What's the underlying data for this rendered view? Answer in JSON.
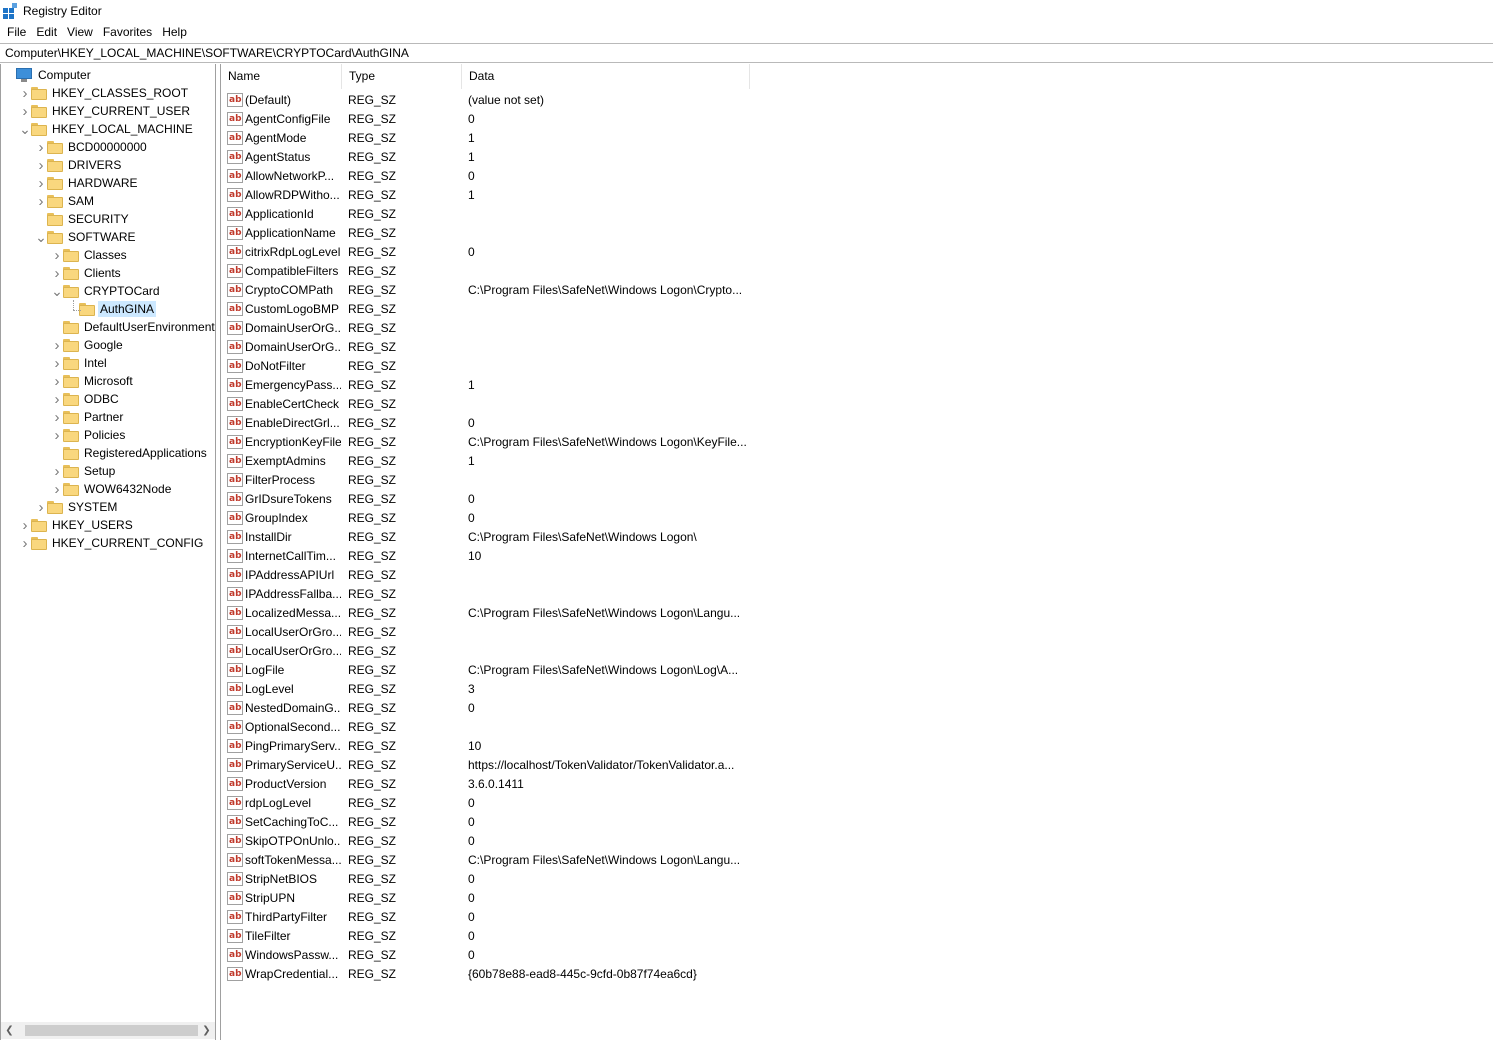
{
  "window": {
    "title": "Registry Editor"
  },
  "menu": [
    "File",
    "Edit",
    "View",
    "Favorites",
    "Help"
  ],
  "address": "Computer\\HKEY_LOCAL_MACHINE\\SOFTWARE\\CRYPTOCard\\AuthGINA",
  "tree": [
    {
      "label": "Computer",
      "depth": 0,
      "icon": "computer",
      "expander": "down"
    },
    {
      "label": "HKEY_CLASSES_ROOT",
      "depth": 1,
      "icon": "folder",
      "expander": "right"
    },
    {
      "label": "HKEY_CURRENT_USER",
      "depth": 1,
      "icon": "folder",
      "expander": "right"
    },
    {
      "label": "HKEY_LOCAL_MACHINE",
      "depth": 1,
      "icon": "folder",
      "expander": "down"
    },
    {
      "label": "BCD00000000",
      "depth": 2,
      "icon": "folder",
      "expander": "right"
    },
    {
      "label": "DRIVERS",
      "depth": 2,
      "icon": "folder",
      "expander": "right"
    },
    {
      "label": "HARDWARE",
      "depth": 2,
      "icon": "folder",
      "expander": "right"
    },
    {
      "label": "SAM",
      "depth": 2,
      "icon": "folder",
      "expander": "right"
    },
    {
      "label": "SECURITY",
      "depth": 2,
      "icon": "folder",
      "expander": "none"
    },
    {
      "label": "SOFTWARE",
      "depth": 2,
      "icon": "folder",
      "expander": "down"
    },
    {
      "label": "Classes",
      "depth": 3,
      "icon": "folder",
      "expander": "right"
    },
    {
      "label": "Clients",
      "depth": 3,
      "icon": "folder",
      "expander": "right"
    },
    {
      "label": "CRYPTOCard",
      "depth": 3,
      "icon": "folder",
      "expander": "down"
    },
    {
      "label": "AuthGINA",
      "depth": 4,
      "icon": "folder",
      "expander": "none",
      "selected": true
    },
    {
      "label": "DefaultUserEnvironment",
      "depth": 3,
      "icon": "folder",
      "expander": "none"
    },
    {
      "label": "Google",
      "depth": 3,
      "icon": "folder",
      "expander": "right"
    },
    {
      "label": "Intel",
      "depth": 3,
      "icon": "folder",
      "expander": "right"
    },
    {
      "label": "Microsoft",
      "depth": 3,
      "icon": "folder",
      "expander": "right"
    },
    {
      "label": "ODBC",
      "depth": 3,
      "icon": "folder",
      "expander": "right"
    },
    {
      "label": "Partner",
      "depth": 3,
      "icon": "folder",
      "expander": "right"
    },
    {
      "label": "Policies",
      "depth": 3,
      "icon": "folder",
      "expander": "right"
    },
    {
      "label": "RegisteredApplications",
      "depth": 3,
      "icon": "folder",
      "expander": "none"
    },
    {
      "label": "Setup",
      "depth": 3,
      "icon": "folder",
      "expander": "right"
    },
    {
      "label": "WOW6432Node",
      "depth": 3,
      "icon": "folder",
      "expander": "right"
    },
    {
      "label": "SYSTEM",
      "depth": 2,
      "icon": "folder",
      "expander": "right"
    },
    {
      "label": "HKEY_USERS",
      "depth": 1,
      "icon": "folder",
      "expander": "right"
    },
    {
      "label": "HKEY_CURRENT_CONFIG",
      "depth": 1,
      "icon": "folder",
      "expander": "right"
    }
  ],
  "columns": [
    "Name",
    "Type",
    "Data"
  ],
  "values": [
    {
      "name": "(Default)",
      "type": "REG_SZ",
      "data": "(value not set)"
    },
    {
      "name": "AgentConfigFile",
      "type": "REG_SZ",
      "data": "0"
    },
    {
      "name": "AgentMode",
      "type": "REG_SZ",
      "data": "1"
    },
    {
      "name": "AgentStatus",
      "type": "REG_SZ",
      "data": "1"
    },
    {
      "name": "AllowNetworkP...",
      "type": "REG_SZ",
      "data": "0"
    },
    {
      "name": "AllowRDPWitho...",
      "type": "REG_SZ",
      "data": "1"
    },
    {
      "name": "ApplicationId",
      "type": "REG_SZ",
      "data": ""
    },
    {
      "name": "ApplicationName",
      "type": "REG_SZ",
      "data": ""
    },
    {
      "name": "citrixRdpLogLevel",
      "type": "REG_SZ",
      "data": "0"
    },
    {
      "name": "CompatibleFilters",
      "type": "REG_SZ",
      "data": ""
    },
    {
      "name": "CryptoCOMPath",
      "type": "REG_SZ",
      "data": "C:\\Program Files\\SafeNet\\Windows Logon\\Crypto..."
    },
    {
      "name": "CustomLogoBMP",
      "type": "REG_SZ",
      "data": ""
    },
    {
      "name": "DomainUserOrG...",
      "type": "REG_SZ",
      "data": ""
    },
    {
      "name": "DomainUserOrG...",
      "type": "REG_SZ",
      "data": ""
    },
    {
      "name": "DoNotFilter",
      "type": "REG_SZ",
      "data": ""
    },
    {
      "name": "EmergencyPass...",
      "type": "REG_SZ",
      "data": "1"
    },
    {
      "name": "EnableCertCheck",
      "type": "REG_SZ",
      "data": ""
    },
    {
      "name": "EnableDirectGrl...",
      "type": "REG_SZ",
      "data": "0"
    },
    {
      "name": "EncryptionKeyFile",
      "type": "REG_SZ",
      "data": "C:\\Program Files\\SafeNet\\Windows Logon\\KeyFile..."
    },
    {
      "name": "ExemptAdmins",
      "type": "REG_SZ",
      "data": "1"
    },
    {
      "name": "FilterProcess",
      "type": "REG_SZ",
      "data": ""
    },
    {
      "name": "GrIDsureTokens",
      "type": "REG_SZ",
      "data": "0"
    },
    {
      "name": "GroupIndex",
      "type": "REG_SZ",
      "data": "0"
    },
    {
      "name": "InstallDir",
      "type": "REG_SZ",
      "data": "C:\\Program Files\\SafeNet\\Windows Logon\\"
    },
    {
      "name": "InternetCallTim...",
      "type": "REG_SZ",
      "data": "10"
    },
    {
      "name": "IPAddressAPIUrl",
      "type": "REG_SZ",
      "data": ""
    },
    {
      "name": "IPAddressFallba...",
      "type": "REG_SZ",
      "data": ""
    },
    {
      "name": "LocalizedMessa...",
      "type": "REG_SZ",
      "data": "C:\\Program Files\\SafeNet\\Windows Logon\\Langu..."
    },
    {
      "name": "LocalUserOrGro...",
      "type": "REG_SZ",
      "data": ""
    },
    {
      "name": "LocalUserOrGro...",
      "type": "REG_SZ",
      "data": ""
    },
    {
      "name": "LogFile",
      "type": "REG_SZ",
      "data": "C:\\Program Files\\SafeNet\\Windows Logon\\Log\\A..."
    },
    {
      "name": "LogLevel",
      "type": "REG_SZ",
      "data": "3"
    },
    {
      "name": "NestedDomainG...",
      "type": "REG_SZ",
      "data": "0"
    },
    {
      "name": "OptionalSecond...",
      "type": "REG_SZ",
      "data": ""
    },
    {
      "name": "PingPrimaryServ...",
      "type": "REG_SZ",
      "data": "10"
    },
    {
      "name": "PrimaryServiceU...",
      "type": "REG_SZ",
      "data": "https://localhost/TokenValidator/TokenValidator.a..."
    },
    {
      "name": "ProductVersion",
      "type": "REG_SZ",
      "data": "3.6.0.1411"
    },
    {
      "name": "rdpLogLevel",
      "type": "REG_SZ",
      "data": "0"
    },
    {
      "name": "SetCachingToC...",
      "type": "REG_SZ",
      "data": "0"
    },
    {
      "name": "SkipOTPOnUnlo...",
      "type": "REG_SZ",
      "data": "0"
    },
    {
      "name": "softTokenMessa...",
      "type": "REG_SZ",
      "data": "C:\\Program Files\\SafeNet\\Windows Logon\\Langu..."
    },
    {
      "name": "StripNetBIOS",
      "type": "REG_SZ",
      "data": "0"
    },
    {
      "name": "StripUPN",
      "type": "REG_SZ",
      "data": "0"
    },
    {
      "name": "ThirdPartyFilter",
      "type": "REG_SZ",
      "data": "0"
    },
    {
      "name": "TileFilter",
      "type": "REG_SZ",
      "data": "0"
    },
    {
      "name": "WindowsPassw...",
      "type": "REG_SZ",
      "data": "0"
    },
    {
      "name": "WrapCredential...",
      "type": "REG_SZ",
      "data": "{60b78e88-ead8-445c-9cfd-0b87f74ea6cd}"
    }
  ],
  "value_icon": "ab",
  "colors": {
    "selection": "#cce8ff",
    "folder": "#f9d77e",
    "string_icon": "#c0392b"
  }
}
